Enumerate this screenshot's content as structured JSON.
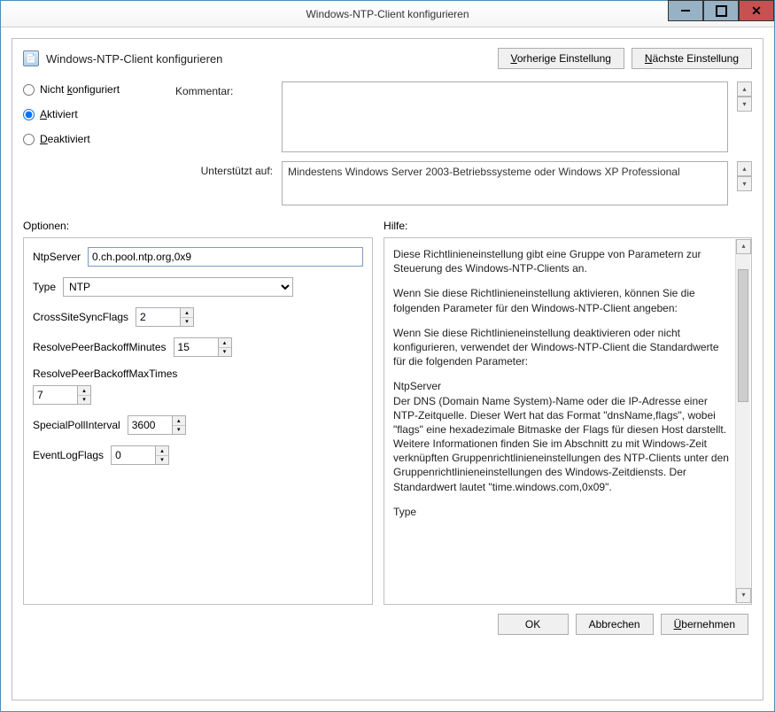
{
  "window": {
    "title": "Windows-NTP-Client konfigurieren"
  },
  "header": {
    "title": "Windows-NTP-Client konfigurieren",
    "prev_button": "Vorherige Einstellung",
    "next_button": "Nächste Einstellung"
  },
  "state": {
    "not_configured": "Nicht konfiguriert",
    "enabled": "Aktiviert",
    "disabled": "Deaktiviert",
    "selected": "enabled"
  },
  "comment": {
    "label": "Kommentar:",
    "value": ""
  },
  "supported": {
    "label": "Unterstützt auf:",
    "value": "Mindestens Windows Server 2003-Betriebssysteme oder Windows XP Professional"
  },
  "sections": {
    "options": "Optionen:",
    "help": "Hilfe:"
  },
  "options": {
    "NtpServer": {
      "label": "NtpServer",
      "value": "0.ch.pool.ntp.org,0x9"
    },
    "Type": {
      "label": "Type",
      "value": "NTP"
    },
    "CrossSiteSyncFlags": {
      "label": "CrossSiteSyncFlags",
      "value": "2"
    },
    "ResolvePeerBackoffMinutes": {
      "label": "ResolvePeerBackoffMinutes",
      "value": "15"
    },
    "ResolvePeerBackoffMaxTimes": {
      "label": "ResolvePeerBackoffMaxTimes",
      "value": "7"
    },
    "SpecialPollInterval": {
      "label": "SpecialPollInterval",
      "value": "3600"
    },
    "EventLogFlags": {
      "label": "EventLogFlags",
      "value": "0"
    }
  },
  "help": {
    "p1": "Diese Richtlinieneinstellung gibt eine Gruppe von Parametern zur Steuerung des Windows-NTP-Clients an.",
    "p2": "Wenn Sie diese Richtlinieneinstellung aktivieren, können Sie die folgenden Parameter für den Windows-NTP-Client angeben:",
    "p3": "Wenn Sie diese Richtlinieneinstellung deaktivieren oder nicht konfigurieren, verwendet der Windows-NTP-Client die Standardwerte für die folgenden Parameter:",
    "p4h": "NtpServer",
    "p4": "Der DNS (Domain Name System)-Name oder die IP-Adresse einer NTP-Zeitquelle. Dieser Wert hat das Format \"dnsName,flags\", wobei \"flags\" eine hexadezimale Bitmaske der Flags für diesen Host darstellt. Weitere Informationen finden Sie im Abschnitt zu mit Windows-Zeit verknüpften Gruppenrichtlinieneinstellungen des NTP-Clients unter den Gruppenrichtlinieneinstellungen des Windows-Zeitdiensts.  Der Standardwert lautet \"time.windows.com,0x09\".",
    "p5h": "Type"
  },
  "footer": {
    "ok": "OK",
    "cancel": "Abbrechen",
    "apply": "Übernehmen"
  }
}
